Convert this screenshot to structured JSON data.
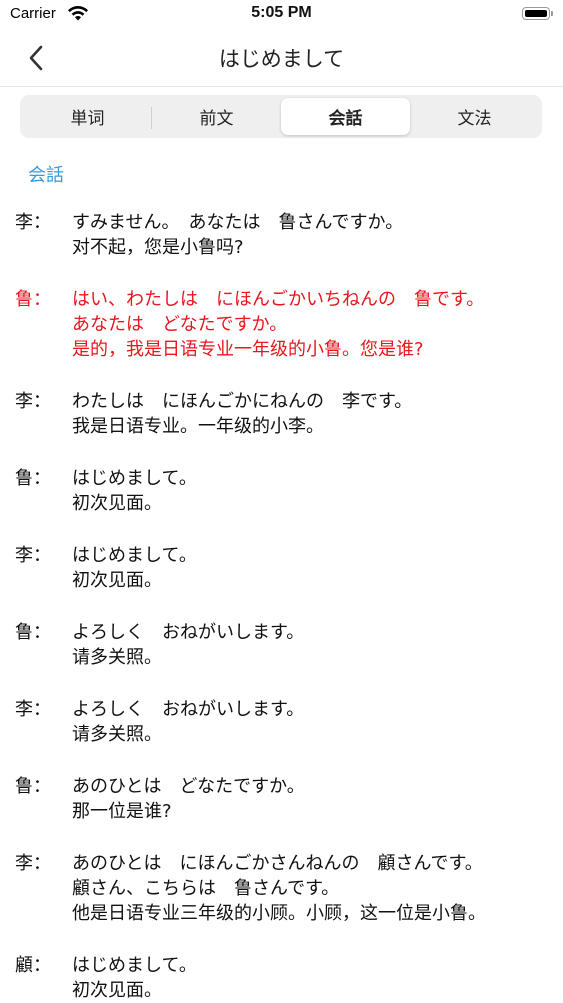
{
  "status_bar": {
    "carrier": "Carrier",
    "time": "5:05 PM",
    "battery_level": 1.0
  },
  "nav": {
    "title": "はじめまして"
  },
  "tabs": [
    {
      "label": "単词",
      "active": false
    },
    {
      "label": "前文",
      "active": false
    },
    {
      "label": "会話",
      "active": true
    },
    {
      "label": "文法",
      "active": false
    }
  ],
  "section": {
    "label": "会話"
  },
  "colors": {
    "accent_blue": "#3a9ad9",
    "highlight_red": "#e8161d"
  },
  "dialogue": [
    {
      "speaker": "李：",
      "highlight": false,
      "lines": [
        "すみません。　あなたは　鲁さんですか。",
        "对不起，您是小鲁吗?"
      ]
    },
    {
      "speaker": "鲁：",
      "highlight": true,
      "lines": [
        "はい、わたしは　にほんごかいちねんの　鲁です。",
        "あなたは　どなたですか。",
        "是的，我是日语专业一年级的小鲁。您是谁?"
      ]
    },
    {
      "speaker": "李：",
      "highlight": false,
      "lines": [
        "わたしは　にほんごかにねんの　李です。",
        "我是日语专业。一年级的小李。"
      ]
    },
    {
      "speaker": "鲁：",
      "highlight": false,
      "lines": [
        "はじめまして。",
        "初次见面。"
      ]
    },
    {
      "speaker": "李：",
      "highlight": false,
      "lines": [
        "はじめまして。",
        "初次见面。"
      ]
    },
    {
      "speaker": "鲁：",
      "highlight": false,
      "lines": [
        "よろしく　おねがいします。",
        "请多关照。"
      ]
    },
    {
      "speaker": "李：",
      "highlight": false,
      "lines": [
        "よろしく　おねがいします。",
        "请多关照。"
      ]
    },
    {
      "speaker": "鲁：",
      "highlight": false,
      "lines": [
        "あのひとは　どなたですか。",
        "那一位是谁?"
      ]
    },
    {
      "speaker": "李：",
      "highlight": false,
      "lines": [
        "あのひとは　にほんごかさんねんの　顧さんです。",
        "顧さん、こちらは　鲁さんです。",
        "他是日语专业三年级的小顾。小顾，这一位是小鲁。"
      ]
    },
    {
      "speaker": "顧：",
      "highlight": false,
      "lines": [
        "はじめまして。",
        "初次见面。"
      ]
    }
  ]
}
